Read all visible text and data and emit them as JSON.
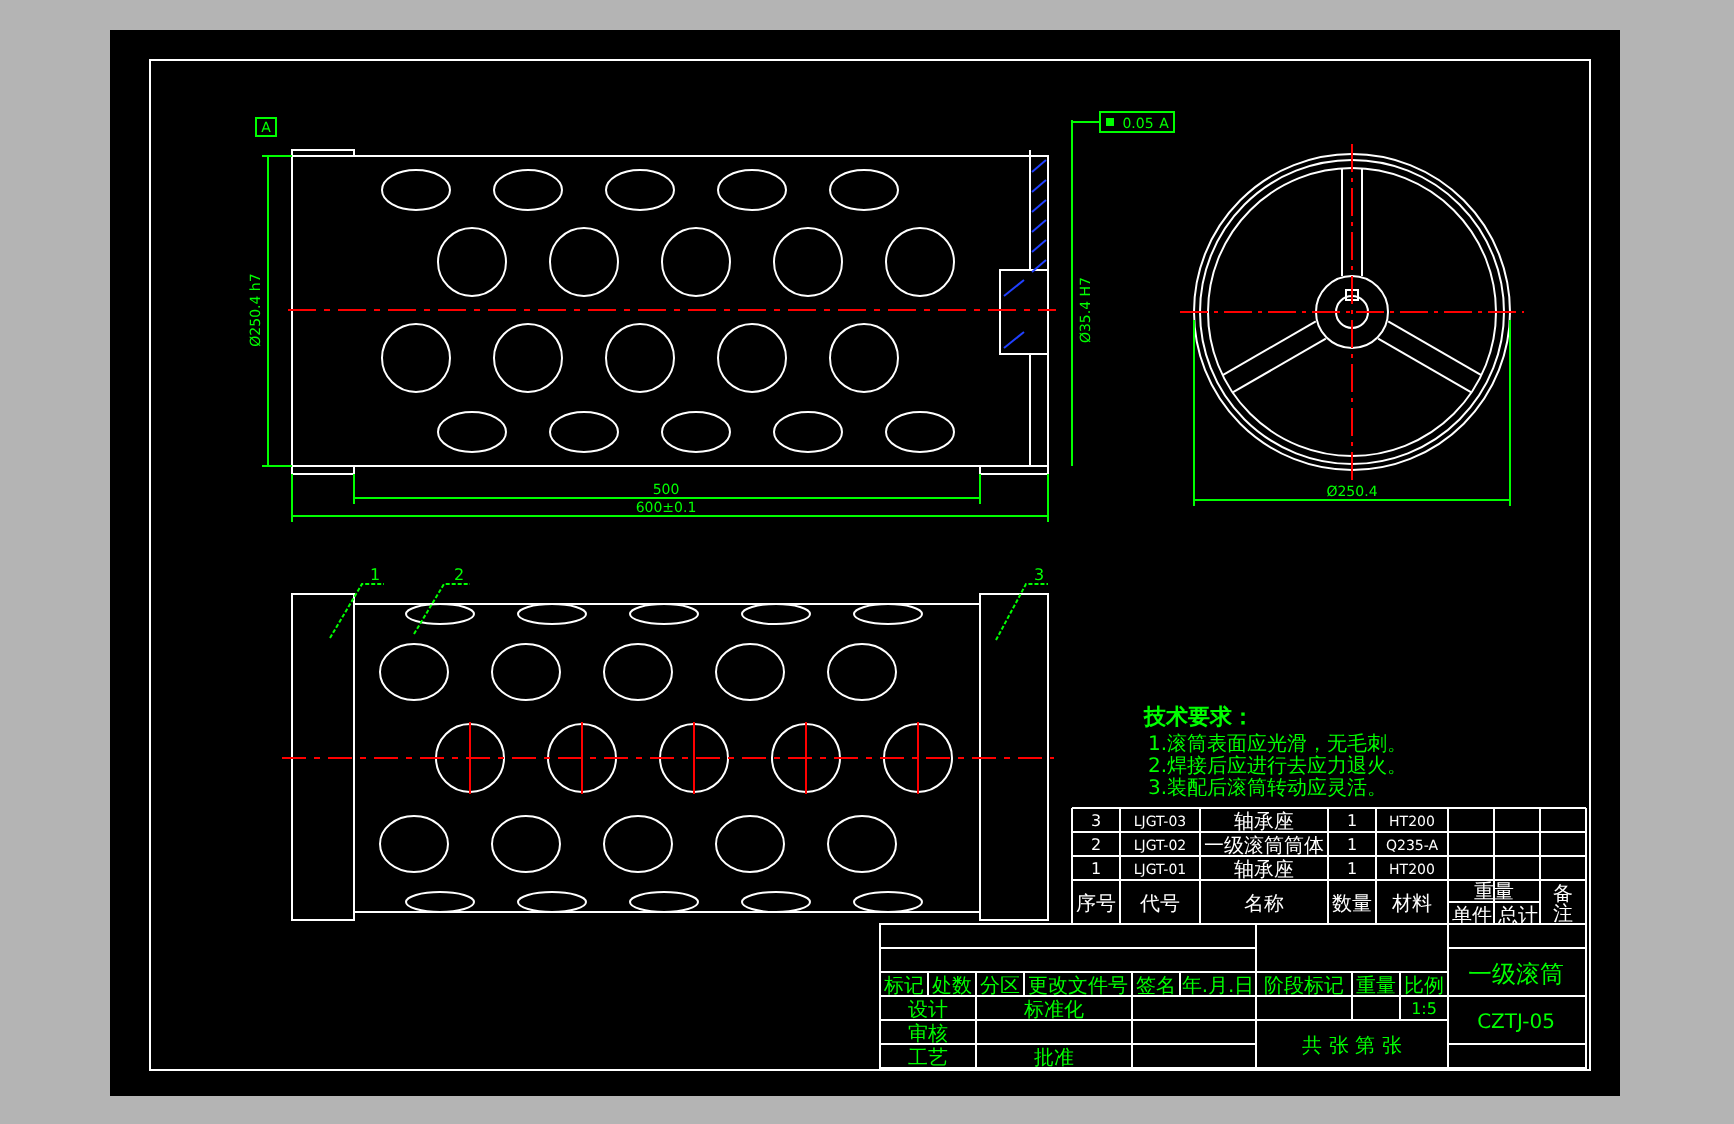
{
  "front_view": {
    "datum_label": "A",
    "dim_diameter": "Ø250.4 h7",
    "dim_bore": "Ø35.4 H7",
    "dim_inner_length": "500",
    "dim_total_length": "600±0.1"
  },
  "tolerance_frame": {
    "value": "0.05",
    "datum": "A"
  },
  "side_view": {
    "dim_diameter": "Ø250.4"
  },
  "balloons": [
    "1",
    "2",
    "3"
  ],
  "requirements": {
    "title": "技术要求：",
    "lines": [
      "1.滚筒表面应光滑，无毛刺。",
      "2.焊接后应进行去应力退火。",
      "3.装配后滚筒转动应灵活。"
    ]
  },
  "parts_list": {
    "rows": [
      {
        "no": "3",
        "code": "LJGT-03",
        "name": "轴承座",
        "qty": "1",
        "material": "HT200"
      },
      {
        "no": "2",
        "code": "LJGT-02",
        "name": "一级滚筒筒体",
        "qty": "1",
        "material": "Q235-A"
      },
      {
        "no": "1",
        "code": "LJGT-01",
        "name": "轴承座",
        "qty": "1",
        "material": "HT200"
      }
    ],
    "header": {
      "no": "序号",
      "code": "代号",
      "name": "名称",
      "qty": "数量",
      "material": "材料",
      "weight": "重量",
      "unit": "单件",
      "total": "总计",
      "note": "备注"
    }
  },
  "title_block": {
    "revision_labels": [
      "标记",
      "处数",
      "分区",
      "更改文件号",
      "签名",
      "年.月.日"
    ],
    "design": "设计",
    "standardization": "标准化",
    "review": "审核",
    "process": "工艺",
    "approve": "批准",
    "stage_mark": "阶段标记",
    "weight": "重量",
    "scale": "比例",
    "scale_value": "1:5",
    "sheets": "共 张 第 张",
    "title": "一级滚筒",
    "drawing_no": "CZTJ-05"
  }
}
